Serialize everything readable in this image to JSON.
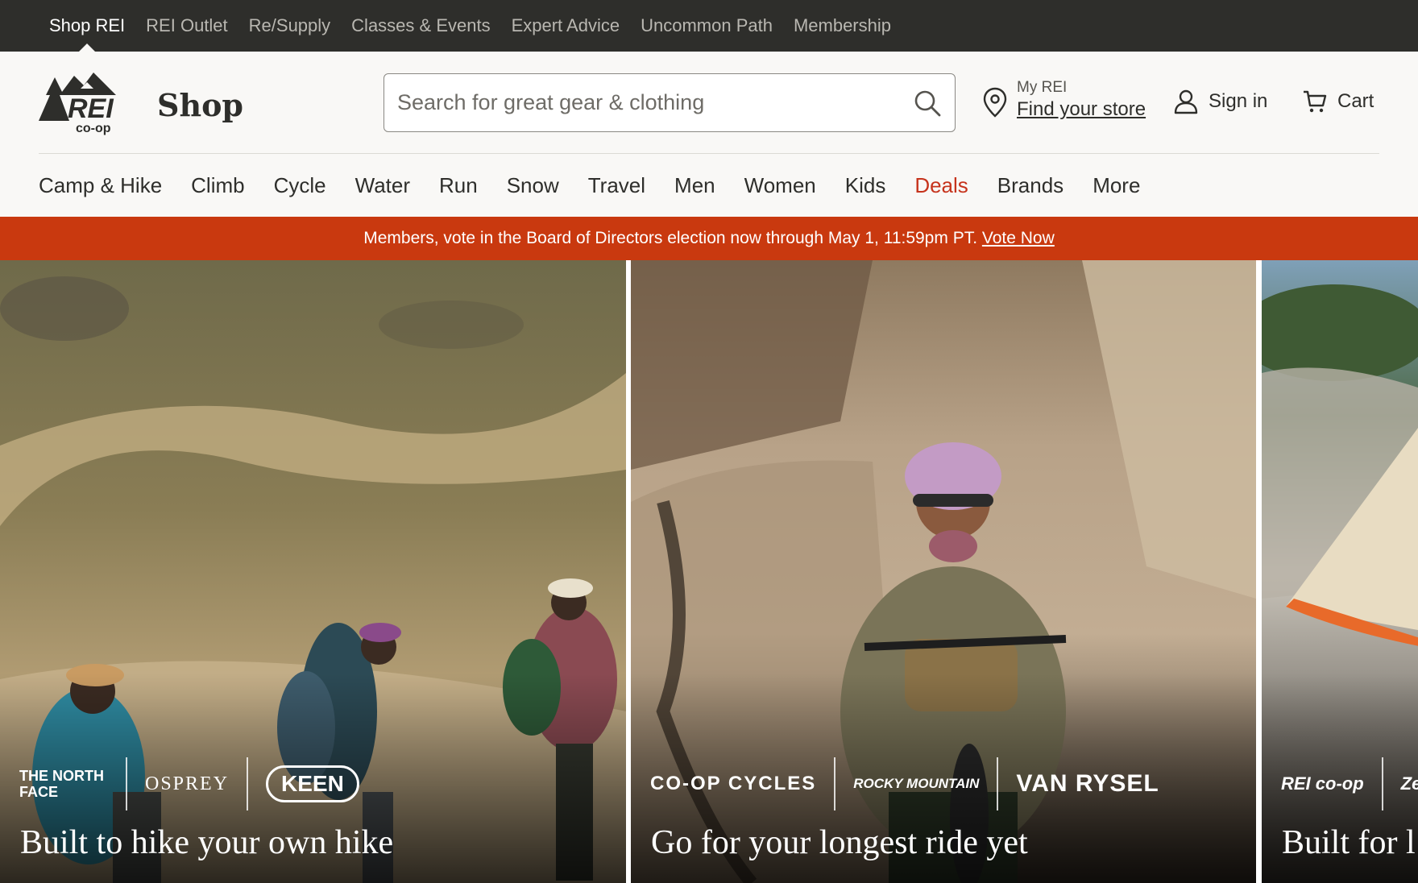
{
  "utility_nav": {
    "items": [
      "Shop REI",
      "REI Outlet",
      "Re/Supply",
      "Classes & Events",
      "Expert Advice",
      "Uncommon Path",
      "Membership"
    ],
    "active": "Shop REI"
  },
  "header": {
    "logo_text": "REI co-op",
    "section_title": "Shop",
    "search": {
      "placeholder": "Search for great gear & clothing",
      "value": ""
    },
    "store": {
      "label": "My REI",
      "link": "Find your store"
    },
    "sign_in": "Sign in",
    "cart": "Cart"
  },
  "category_nav": {
    "items": [
      "Camp & Hike",
      "Climb",
      "Cycle",
      "Water",
      "Run",
      "Snow",
      "Travel",
      "Men",
      "Women",
      "Kids",
      "Deals",
      "Brands",
      "More"
    ],
    "highlight": "Deals",
    "highlight_color": "#c6331c"
  },
  "banner": {
    "text": "Members, vote in the Board of Directors election now through May 1, 11:59pm PT.",
    "link": "Vote Now",
    "color": "#c9390f"
  },
  "hero_cards": [
    {
      "headline": "Built to hike your own hike",
      "brands": [
        "THE NORTH FACE",
        "OSPREY",
        "KEEN"
      ]
    },
    {
      "headline": "Go for your longest ride yet",
      "brands": [
        "CO-OP CYCLES",
        "ROCKY MOUNTAIN",
        "VAN RYSEL"
      ]
    },
    {
      "headline": "Built for l",
      "brands": [
        "REI co-op",
        "Zen"
      ]
    }
  ],
  "colors": {
    "top_bar": "#2e2e2b",
    "page_bg": "#f9f8f6",
    "text": "#2e2e2b"
  }
}
